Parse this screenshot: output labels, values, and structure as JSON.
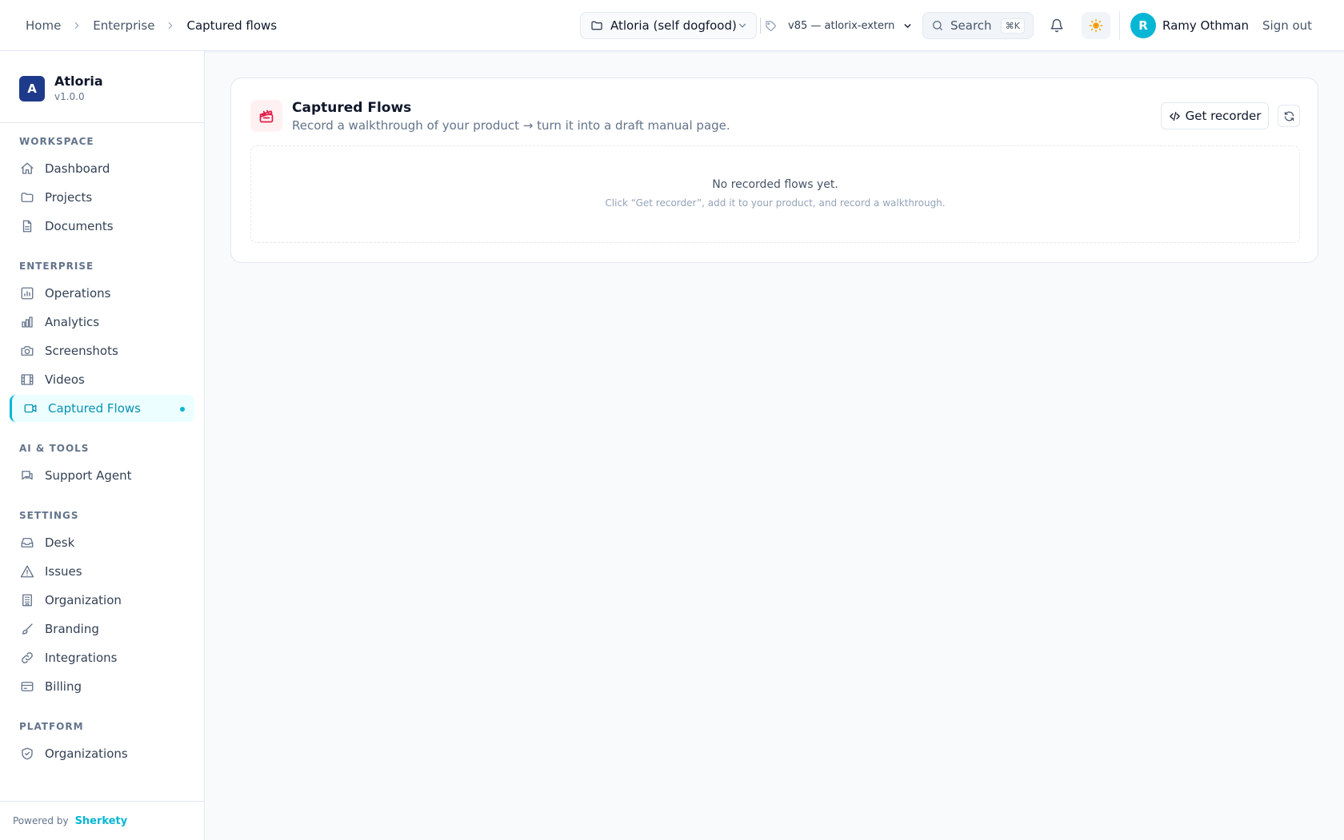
{
  "breadcrumb": {
    "home": "Home",
    "section": "Enterprise",
    "current": "Captured flows"
  },
  "header": {
    "project": "Atloria (self dogfood)",
    "version": "v85 — atlorix-extern",
    "search_label": "Search",
    "search_shortcut": "⌘K",
    "user_initial": "R",
    "user_name": "Ramy Othman",
    "signout": "Sign out"
  },
  "brand": {
    "logo_letter": "A",
    "name": "Atloria",
    "version": "v1.0.0"
  },
  "sidebar": {
    "sections": {
      "workspace": "WORKSPACE",
      "enterprise": "ENTERPRISE",
      "ai_tools": "AI & TOOLS",
      "settings": "SETTINGS",
      "platform": "PLATFORM"
    },
    "items": {
      "dashboard": "Dashboard",
      "projects": "Projects",
      "documents": "Documents",
      "operations": "Operations",
      "analytics": "Analytics",
      "screenshots": "Screenshots",
      "videos": "Videos",
      "captured_flows": "Captured Flows",
      "support_agent": "Support Agent",
      "desk": "Desk",
      "issues": "Issues",
      "organization": "Organization",
      "branding": "Branding",
      "integrations": "Integrations",
      "billing": "Billing",
      "organizations": "Organizations"
    },
    "active_item": "captured_flows",
    "footer": {
      "powered_by": "Powered by",
      "vendor": "Sherkety"
    }
  },
  "card": {
    "title": "Captured Flows",
    "subtitle": "Record a walkthrough of your product → turn it into a draft manual page.",
    "get_recorder": "Get recorder",
    "empty_title": "No recorded flows yet.",
    "empty_sub": "Click “Get recorder”, add it to your product, and record a walkthrough."
  },
  "colors": {
    "accent": "#06b6d4",
    "brand_logo": "#1e3a8a",
    "card_icon": "#e11d48",
    "theme_icon": "#f59e0b"
  },
  "icons": {
    "breadcrumb_separator": "chevron-right-icon",
    "project": "folder-icon",
    "version": "tag-icon",
    "search": "search-icon",
    "notifications": "bell-icon",
    "theme": "sun-icon",
    "card": "clapperboard-icon",
    "get_recorder": "code-icon",
    "refresh": "refresh-icon"
  }
}
